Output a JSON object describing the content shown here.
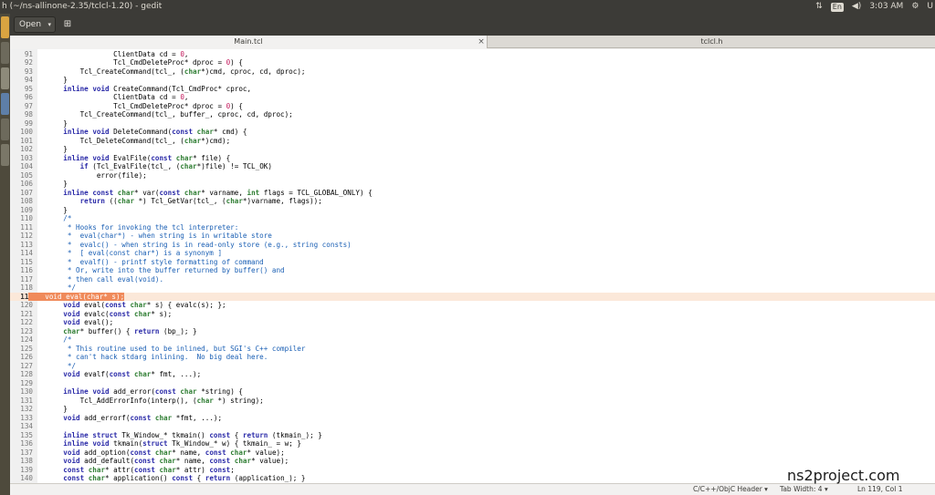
{
  "window": {
    "title": "h (~/ns-allinone-2.35/tclcl-1.20) - gedit"
  },
  "tray": {
    "kbd_label": "En",
    "time": "3:03 AM",
    "user_initial": "U"
  },
  "toolbar": {
    "open_label": "Open",
    "open_caret": "▾",
    "new_tab_glyph": "⊞"
  },
  "tabs": [
    {
      "label": "Main.tcl",
      "close": "×",
      "active": true
    },
    {
      "label": "tclcl.h",
      "active": false
    }
  ],
  "editor": {
    "current_line": 119,
    "lines": [
      {
        "n": "91",
        "text": "                ClientData cd = 0,"
      },
      {
        "n": "92",
        "text": "                Tcl_CmdDeleteProc* dproc = 0) {"
      },
      {
        "n": "93",
        "text": "        Tcl_CreateCommand(tcl_, (char*)cmd, cproc, cd, dproc);"
      },
      {
        "n": "94",
        "text": "    }"
      },
      {
        "n": "95",
        "text": "    inline void CreateCommand(Tcl_CmdProc* cproc,"
      },
      {
        "n": "96",
        "text": "                ClientData cd = 0,"
      },
      {
        "n": "97",
        "text": "                Tcl_CmdDeleteProc* dproc = 0) {"
      },
      {
        "n": "98",
        "text": "        Tcl_CreateCommand(tcl_, buffer_, cproc, cd, dproc);"
      },
      {
        "n": "99",
        "text": "    }"
      },
      {
        "n": "100",
        "text": "    inline void DeleteCommand(const char* cmd) {"
      },
      {
        "n": "101",
        "text": "        Tcl_DeleteCommand(tcl_, (char*)cmd);"
      },
      {
        "n": "102",
        "text": "    }"
      },
      {
        "n": "103",
        "text": "    inline void EvalFile(const char* file) {"
      },
      {
        "n": "104",
        "text": "        if (Tcl_EvalFile(tcl_, (char*)file) != TCL_OK)"
      },
      {
        "n": "105",
        "text": "            error(file);"
      },
      {
        "n": "106",
        "text": "    }"
      },
      {
        "n": "107",
        "text": "    inline const char* var(const char* varname, int flags = TCL_GLOBAL_ONLY) {"
      },
      {
        "n": "108",
        "text": "        return ((char *) Tcl_GetVar(tcl_, (char*)varname, flags));"
      },
      {
        "n": "109",
        "text": "    }"
      },
      {
        "n": "110",
        "text": "    /*"
      },
      {
        "n": "111",
        "text": "     * Hooks for invoking the tcl interpreter:"
      },
      {
        "n": "112",
        "text": "     *  eval(char*) - when string is in writable store"
      },
      {
        "n": "113",
        "text": "     *  evalc() - when string is in read-only store (e.g., string consts)"
      },
      {
        "n": "114",
        "text": "     *  [ eval(const char*) is a synonym ]"
      },
      {
        "n": "115",
        "text": "     *  evalf() - printf style formatting of command"
      },
      {
        "n": "116",
        "text": "     * Or, write into the buffer returned by buffer() and"
      },
      {
        "n": "117",
        "text": "     * then call eval(void)."
      },
      {
        "n": "118",
        "text": "     */"
      },
      {
        "n": "119",
        "text": "    void eval(char* s);"
      },
      {
        "n": "120",
        "text": "    void eval(const char* s) { evalc(s); };"
      },
      {
        "n": "121",
        "text": "    void evalc(const char* s);"
      },
      {
        "n": "122",
        "text": "    void eval();"
      },
      {
        "n": "123",
        "text": "    char* buffer() { return (bp_); }"
      },
      {
        "n": "124",
        "text": "    /*"
      },
      {
        "n": "125",
        "text": "     * This routine used to be inlined, but SGI's C++ compiler"
      },
      {
        "n": "126",
        "text": "     * can't hack stdarg inlining.  No big deal here."
      },
      {
        "n": "127",
        "text": "     */"
      },
      {
        "n": "128",
        "text": "    void evalf(const char* fmt, ...);"
      },
      {
        "n": "129",
        "text": ""
      },
      {
        "n": "130",
        "text": "    inline void add_error(const char *string) {"
      },
      {
        "n": "131",
        "text": "        Tcl_AddErrorInfo(interp(), (char *) string);"
      },
      {
        "n": "132",
        "text": "    }"
      },
      {
        "n": "133",
        "text": "    void add_errorf(const char *fmt, ...);"
      },
      {
        "n": "134",
        "text": ""
      },
      {
        "n": "135",
        "text": "    inline struct Tk_Window_* tkmain() const { return (tkmain_); }"
      },
      {
        "n": "136",
        "text": "    inline void tkmain(struct Tk_Window_* w) { tkmain_ = w; }"
      },
      {
        "n": "137",
        "text": "    void add_option(const char* name, const char* value);"
      },
      {
        "n": "138",
        "text": "    void add_default(const char* name, const char* value);"
      },
      {
        "n": "139",
        "text": "    const char* attr(const char* attr) const;"
      },
      {
        "n": "140",
        "text": "    const char* application() const { return (application_); }"
      }
    ]
  },
  "status": {
    "language": "C/C++/ObjC Header",
    "tab_width": "Tab Width: 4",
    "position": "Ln 119, Col 1",
    "dropdown_caret": "▾"
  },
  "watermark": "ns2project.com",
  "colors": {
    "current_line_bg": "#fbe8d9",
    "selection": "#f08a5a",
    "keyword": "#2a2aa8",
    "type": "#2e7d32",
    "comment": "#1a5fb4",
    "number": "#c2185b"
  }
}
